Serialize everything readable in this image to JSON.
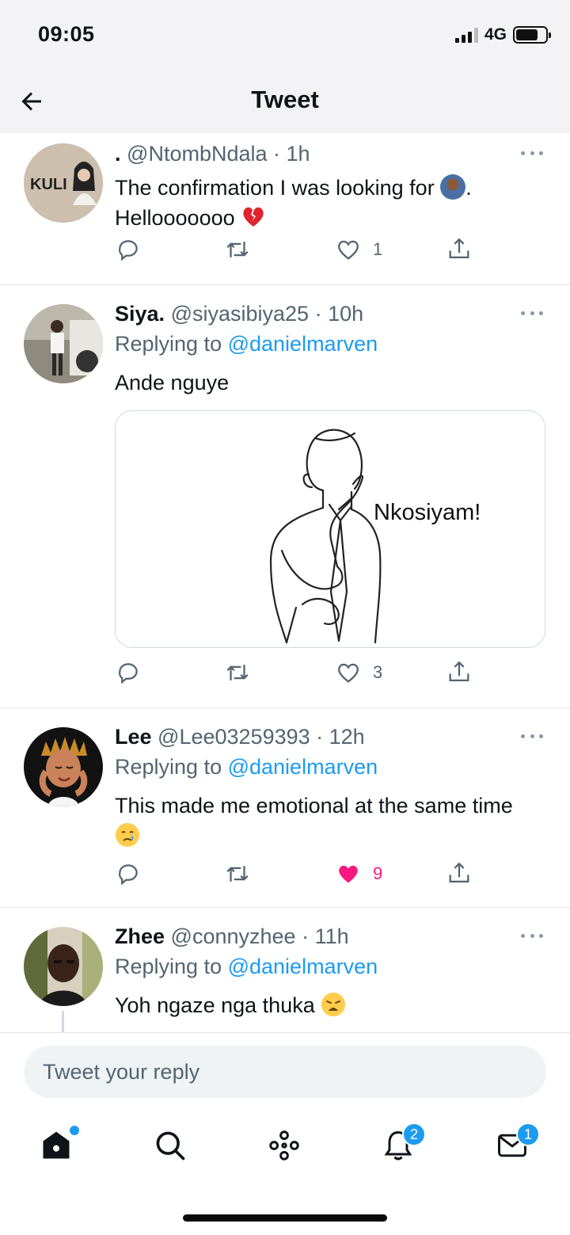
{
  "status_bar": {
    "time": "09:05",
    "network": "4G",
    "battery_level": 0.76
  },
  "header": {
    "title": "Tweet"
  },
  "tweets": [
    {
      "name": ".",
      "handle": "@NtombNdala",
      "time": "· 1h",
      "text": "The confirmation I was looking for ",
      "text_end": ".",
      "text_line2": "Hellooooooo ",
      "avatar_text": "KULI",
      "likes": "1",
      "liked": false
    },
    {
      "name": "Siya.",
      "handle": "@siyasibiya25",
      "time": "· 10h",
      "replying_prefix": "Replying to ",
      "replying_handle": "@danielmarven",
      "text": "Ande nguye",
      "media_caption": "Nkosiyam!",
      "likes": "3",
      "liked": false
    },
    {
      "name": "Lee",
      "handle": "@Lee03259393",
      "time": "· 12h",
      "replying_prefix": "Replying to ",
      "replying_handle": "@danielmarven",
      "text": "This made me emotional at the same time",
      "likes": "9",
      "liked": true
    },
    {
      "name": "Zhee",
      "handle": "@connyzhee",
      "time": "· 11h",
      "replying_prefix": "Replying to ",
      "replying_handle": "@danielmarven",
      "text": "Yoh ngaze nga thuka "
    }
  ],
  "compose": {
    "placeholder": "Tweet your reply"
  },
  "tab_bar": {
    "notifications_badge": "2",
    "messages_badge": "1"
  },
  "colors": {
    "accent": "#1d9bf0",
    "like": "#f91880",
    "muted": "#536471"
  }
}
